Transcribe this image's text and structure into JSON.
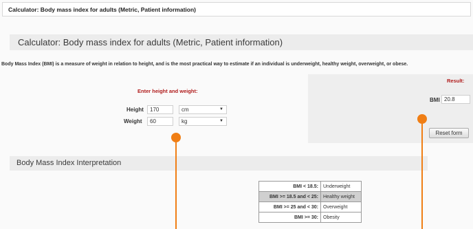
{
  "window": {
    "title": "Calculator: Body mass index for adults (Metric, Patient information)"
  },
  "calculator": {
    "heading": "Calculator: Body mass index for adults (Metric, Patient information)",
    "intro": "Body Mass Index (BMI) is a measure of weight in relation to height, and is the most practical way to estimate if an individual is underweight, healthy weight, overweight, or obese.",
    "input_prompt": "Enter height and weight:",
    "height": {
      "label": "Height",
      "value": "170",
      "unit": "cm"
    },
    "weight": {
      "label": "Weight",
      "value": "60",
      "unit": "kg"
    }
  },
  "result": {
    "label": "Result:",
    "bmi_label": "BMI",
    "bmi_value": "20.8",
    "reset_label": "Reset form"
  },
  "interpretation": {
    "heading": "Body Mass Index Interpretation",
    "rows": [
      {
        "range": "BMI < 18.5:",
        "class": "Underweight",
        "highlighted": false
      },
      {
        "range": "BMI >= 18.5 and < 25:",
        "class": "Healthy weight",
        "highlighted": true
      },
      {
        "range": "BMI >= 25 and < 30:",
        "class": "Overweight",
        "highlighted": false
      },
      {
        "range": "BMI >= 30:",
        "class": "Obesity",
        "highlighted": false
      }
    ]
  },
  "annotation_color": "#f07e14"
}
